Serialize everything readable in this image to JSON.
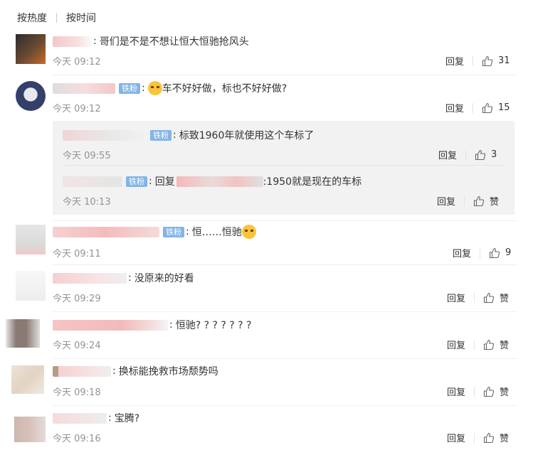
{
  "tabs": {
    "hot": "按热度",
    "time": "按时间"
  },
  "labels": {
    "reply": "回复",
    "like": "赞"
  },
  "colors": {
    "badge": "#83b4e6",
    "time": "#939393"
  },
  "comments": [
    {
      "text": "哥们是不是不想让恒大恒驰抢风头",
      "time": "今天 09:12",
      "likes": "31"
    },
    {
      "badge": "铁粉",
      "emoji": "grimace-emoji",
      "text": "车不好好做，标也不好好做?",
      "time": "今天 09:12",
      "likes": "15"
    },
    {
      "badge": "铁粉",
      "text": "恒……恒驰",
      "emoji": "surprised-emoji",
      "time": "今天 09:11",
      "likes": "9"
    },
    {
      "text": "没原来的好看",
      "time": "今天 09:29"
    },
    {
      "text": "恒驰? ? ? ? ? ? ?",
      "time": "今天 09:24"
    },
    {
      "text": "换标能挽救市场颓势吗",
      "time": "今天 09:18"
    },
    {
      "text": "宝腾?",
      "time": "今天 09:16"
    }
  ],
  "replies": [
    {
      "badge": "铁粉",
      "text": "标致1960年就使用这个车标了",
      "time": "今天 09:55",
      "likes": "3"
    },
    {
      "badge": "铁粉",
      "prefix": "回复",
      "text": ":1950就是现在的车标",
      "time": "今天 10:13"
    }
  ]
}
